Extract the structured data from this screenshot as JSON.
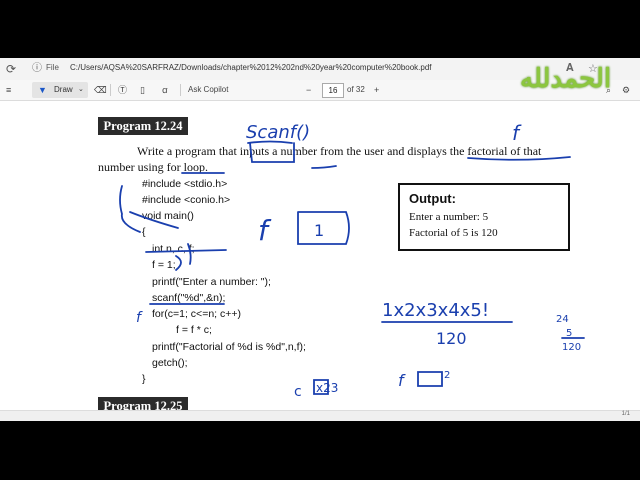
{
  "browser": {
    "file_label": "File",
    "url": "C:/Users/AQSA%20SARFRAZ/Downloads/chapter%2012%202nd%20year%20computer%20book.pdf"
  },
  "toolbar": {
    "draw_label": "Draw",
    "copilot_label": "Ask Copilot",
    "page_number": "16",
    "page_total": "of 32"
  },
  "stamp_text": "الحمدلله",
  "document": {
    "heading": "Program 12.24",
    "next_heading": "Program 12.25",
    "description_line1": "Write a program that inputs a number from the user and displays the factorial of that",
    "description_line2": "number using for loop.",
    "code_lines": [
      "#include <stdio.h>",
      "#include <conio.h>",
      "void main()",
      "{",
      "int n, c, f;",
      "f = 1;",
      "printf(\"Enter a number: \");",
      "scanf(\"%d\",&n);",
      "for(c=1; c<=n; c++)",
      "f = f * c;",
      "printf(\"Factorial of %d is %d\",n,f);",
      "getch();",
      "}"
    ],
    "output": {
      "title": "Output:",
      "line1": "Enter a number: 5",
      "line2": "Factorial of 5 is 120"
    }
  },
  "annotations": {
    "scanf_note": "Scanf()",
    "f_note": "f",
    "box_value": "1",
    "multiplication": "1x2x3x4x5!",
    "result": "120",
    "side_calc_top": "24",
    "side_calc_mid": "5",
    "side_calc_bottom": "120",
    "c_note": "c",
    "c_values": "x23",
    "f_bottom_note": "f",
    "f_power": "2"
  },
  "status": {
    "page_indicator": "1/1"
  },
  "colors": {
    "ink": "#1a3fae",
    "stamp": "#8cc63f",
    "draw_accent": "#1a56c7"
  }
}
